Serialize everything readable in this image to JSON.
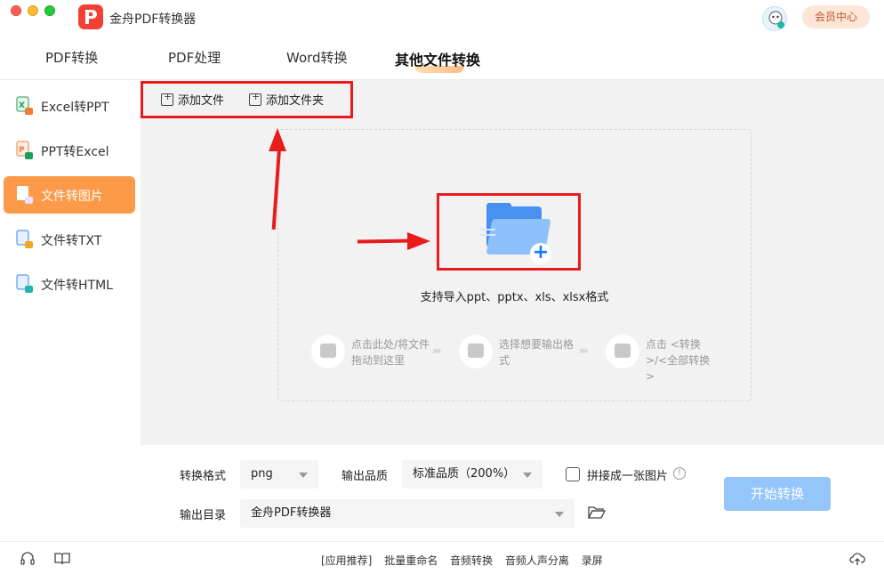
{
  "window": {
    "app_title": "金舟PDF转换器"
  },
  "header": {
    "member_label": "会员中心"
  },
  "tabs": [
    {
      "label": "PDF转换",
      "active": false
    },
    {
      "label": "PDF处理",
      "active": false
    },
    {
      "label": "Word转换",
      "active": false
    },
    {
      "label": "其他文件转换",
      "active": true
    }
  ],
  "sidebar": {
    "items": [
      {
        "label": "Excel转PPT",
        "icon": "excel-to-ppt-icon",
        "active": false
      },
      {
        "label": "PPT转Excel",
        "icon": "ppt-to-excel-icon",
        "active": false
      },
      {
        "label": "文件转图片",
        "icon": "file-to-image-icon",
        "active": true
      },
      {
        "label": "文件转TXT",
        "icon": "file-to-txt-icon",
        "active": false
      },
      {
        "label": "文件转HTML",
        "icon": "file-to-html-icon",
        "active": false
      }
    ]
  },
  "toolbar": {
    "add_file": "添加文件",
    "add_folder": "添加文件夹"
  },
  "dropzone": {
    "support_text": "支持导入ppt、pptx、xls、xlsx格式",
    "steps": [
      {
        "text": "点击此处/将文件拖动到这里",
        "icon": "folder-step-icon"
      },
      {
        "text": "选择想要输出格式",
        "icon": "export-step-icon"
      },
      {
        "text": "点击 <转换>/<全部转换>",
        "icon": "convert-step-icon"
      }
    ],
    "step_separator": "›››"
  },
  "settings": {
    "format_label": "转换格式",
    "format_value": "png",
    "quality_label": "输出品质",
    "quality_value": "标准品质（200%）",
    "merge_label": "拼接成一张图片",
    "merge_checked": false,
    "output_label": "输出目录",
    "output_value": "金舟PDF转换器",
    "start_label": "开始转换",
    "info_glyph": "!"
  },
  "footer": {
    "links": [
      "[应用推荐]",
      "批量重命名",
      "音频转换",
      "音频人声分离",
      "录屏"
    ]
  },
  "colors": {
    "accent": "#fd9a4a",
    "primary_button": "#94c5fb",
    "annotation_red": "#e81c1c",
    "brand_red": "#f04134"
  }
}
